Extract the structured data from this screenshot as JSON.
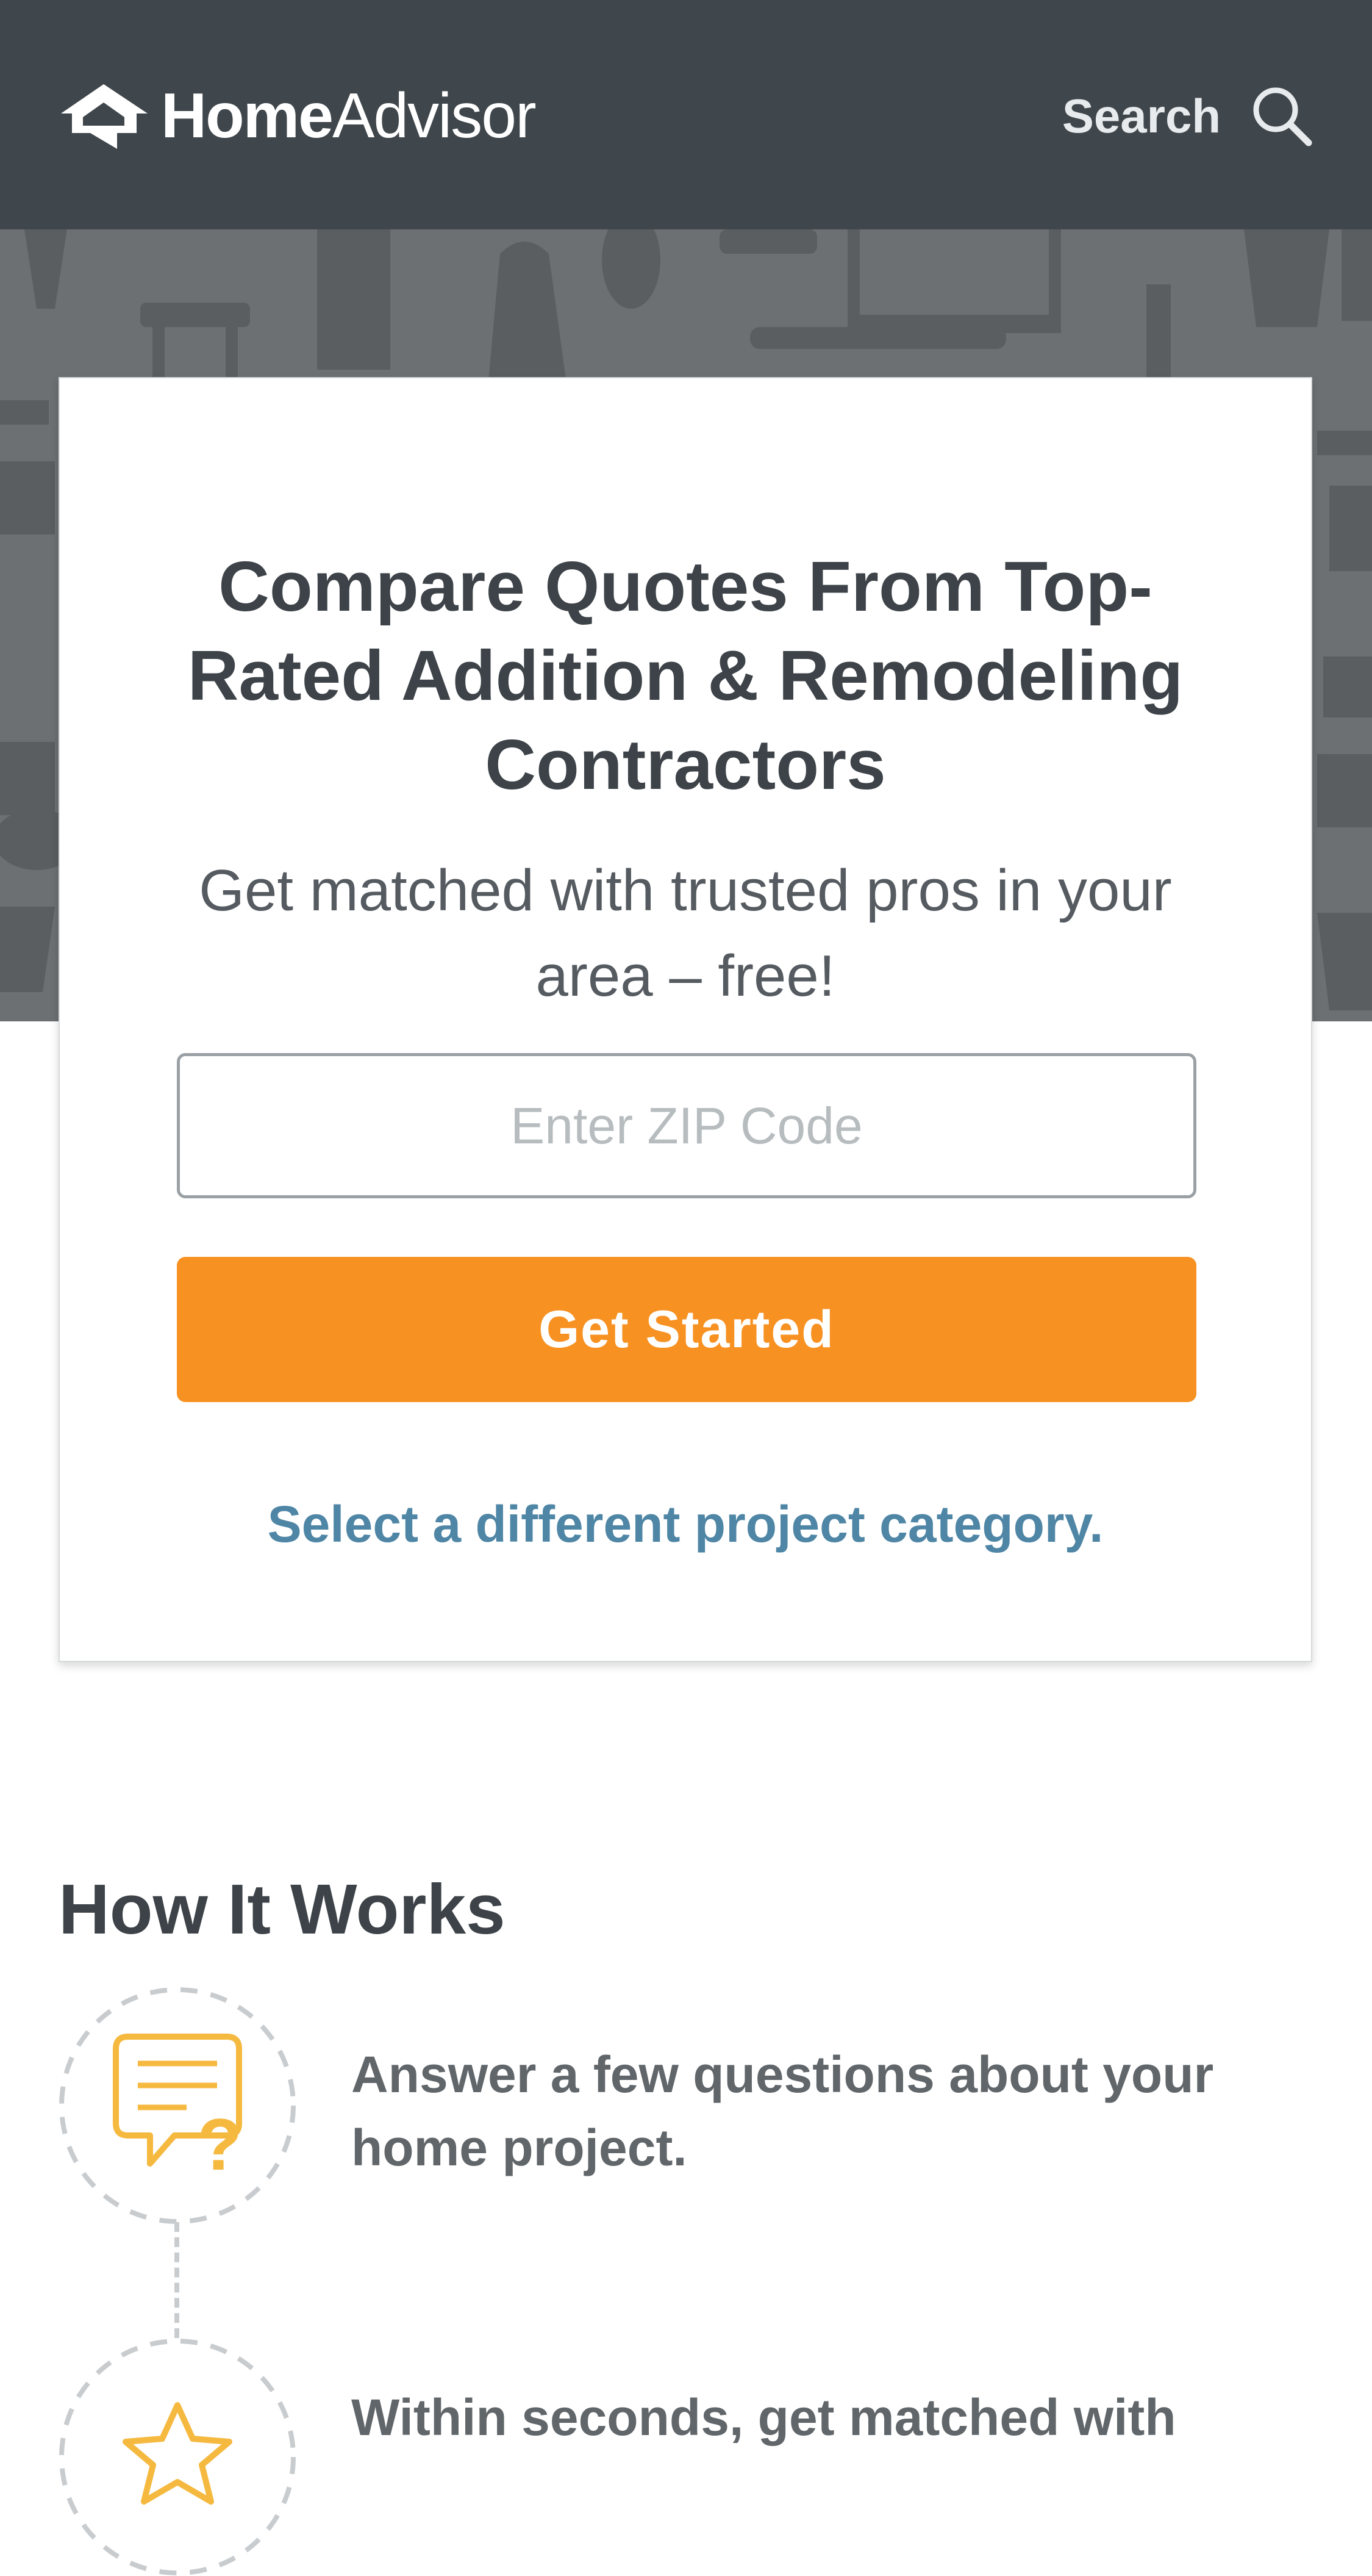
{
  "header": {
    "brand_bold": "Home",
    "brand_light": "Advisor",
    "search_label": "Search"
  },
  "card": {
    "title": "Compare Quotes From Top-Rated Addition & Remodeling Contractors",
    "subtitle": "Get matched with trusted pros in your area – free!",
    "zip_placeholder": "Enter ZIP Code",
    "zip_value": "",
    "cta_label": "Get Started",
    "category_link": "Select a different project category."
  },
  "how_it_works": {
    "title": "How It Works",
    "steps": [
      {
        "icon": "chat-question-icon",
        "text": "Answer a few questions about your home project."
      },
      {
        "icon": "star-icon",
        "text": "Within seconds, get matched with"
      }
    ]
  },
  "colors": {
    "header_bg": "#40474c",
    "hero_bg": "#6d7073",
    "accent_orange": "#f79121",
    "link_blue": "#4f86a6",
    "text_dark": "#3d4348",
    "icon_gold": "#f5b93f"
  }
}
